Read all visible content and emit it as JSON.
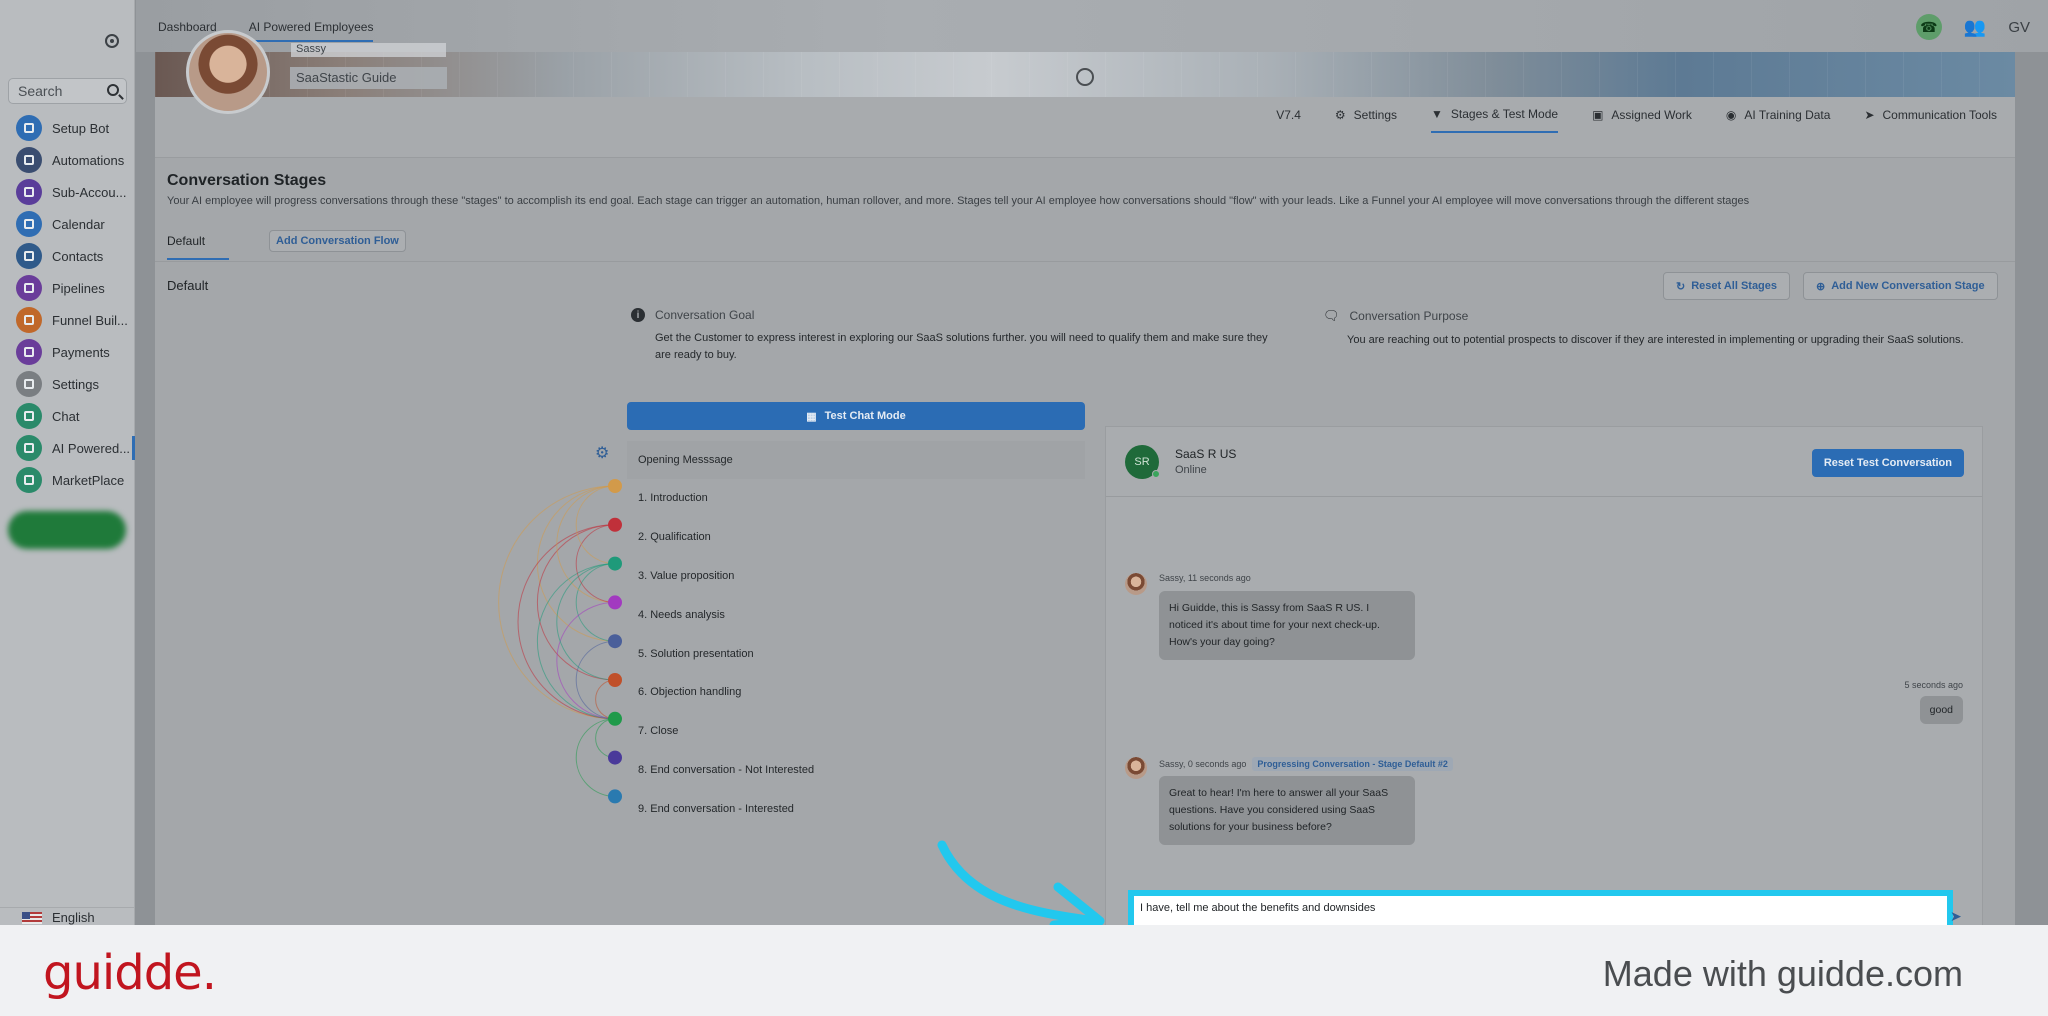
{
  "sidebar": {
    "search_placeholder": "Search",
    "items": [
      {
        "label": "Setup Bot",
        "color": "#2f6db3"
      },
      {
        "label": "Automations",
        "color": "#3a4d70"
      },
      {
        "label": "Sub-Accou...",
        "color": "#5a3d9a"
      },
      {
        "label": "Calendar",
        "color": "#2f6db3"
      },
      {
        "label": "Contacts",
        "color": "#2f5a8a"
      },
      {
        "label": "Pipelines",
        "color": "#6a3d9a"
      },
      {
        "label": "Funnel Buil...",
        "color": "#c0682a"
      },
      {
        "label": "Payments",
        "color": "#6a3d9a"
      },
      {
        "label": "Settings",
        "color": "#7a7e82"
      },
      {
        "label": "Chat",
        "color": "#2a8a6a"
      },
      {
        "label": "AI Powered...",
        "color": "#2a8a6a"
      },
      {
        "label": "MarketPlace",
        "color": "#2a8a6a"
      }
    ],
    "language": "English"
  },
  "topbar": {
    "breadcrumbs": [
      "Dashboard",
      "AI Powered Employees"
    ],
    "user_initials": "GV"
  },
  "employee": {
    "name": "Sassy",
    "role": "SaaStastic Guide"
  },
  "tabs": {
    "version": "V7.4",
    "items": [
      "Settings",
      "Stages & Test Mode",
      "Assigned Work",
      "AI Training Data",
      "Communication Tools"
    ],
    "active": "Stages & Test Mode"
  },
  "conversation_stages": {
    "title": "Conversation Stages",
    "description": "Your AI employee will progress conversations through these \"stages\" to accomplish its end goal. Each stage can trigger an automation, human rollover, and more. Stages tell your AI employee how conversations should \"flow\" with your leads. Like a Funnel your AI employee will move conversations through the different stages",
    "flow_tab": "Default",
    "add_flow_label": "Add Conversation Flow",
    "sub_title": "Default",
    "reset_all_label": "Reset All Stages",
    "add_stage_label": "Add New Conversation Stage",
    "goal_heading": "Conversation Goal",
    "goal_text": "Get the Customer to express interest in exploring our SaaS solutions further. you will need to qualify them and make sure they are ready to buy.",
    "purpose_heading": "Conversation Purpose",
    "purpose_text": "You are reaching out to potential prospects to discover if they are interested in implementing or upgrading their SaaS solutions.",
    "test_chat_label": "Test Chat Mode",
    "stages": [
      {
        "label": "Opening Messsage"
      },
      {
        "label": "1. Introduction",
        "color": "#d29a4a"
      },
      {
        "label": "2. Qualification",
        "color": "#c0303a"
      },
      {
        "label": "3. Value proposition",
        "color": "#1f9a7a"
      },
      {
        "label": "4. Needs analysis",
        "color": "#a23ac0"
      },
      {
        "label": "5. Solution presentation",
        "color": "#4a5f9a"
      },
      {
        "label": "6. Objection handling",
        "color": "#c0502a"
      },
      {
        "label": "7. Close",
        "color": "#1f9a4a"
      },
      {
        "label": "8. End conversation - Not Interested",
        "color": "#4a3a9a"
      },
      {
        "label": "9. End conversation - Interested",
        "color": "#2a7ab0"
      }
    ]
  },
  "chat": {
    "avatar_initials": "SR",
    "contact_name": "SaaS R US",
    "status": "Online",
    "reset_label": "Reset Test Conversation",
    "messages": [
      {
        "meta": "Sassy, 11 seconds ago",
        "text": "Hi Guidde, this is Sassy from SaaS R US. I noticed it's about time for your next check-up. How's your day going?"
      },
      {
        "meta": "5 seconds ago",
        "text": "good"
      },
      {
        "meta": "Sassy, 0 seconds ago",
        "badge": "Progressing Conversation - Stage Default #2",
        "text": "Great to hear! I'm here to answer all your SaaS questions. Have you considered using SaaS solutions for your business before?"
      }
    ],
    "input_value": "I have, tell me about the benefits and downsides"
  },
  "footer": {
    "brand": "guidde.",
    "made_with": "Made with guidde.com"
  },
  "colors": {
    "accent": "#2b6cb4",
    "highlight": "#22c8ee",
    "brand": "#c1151f"
  }
}
